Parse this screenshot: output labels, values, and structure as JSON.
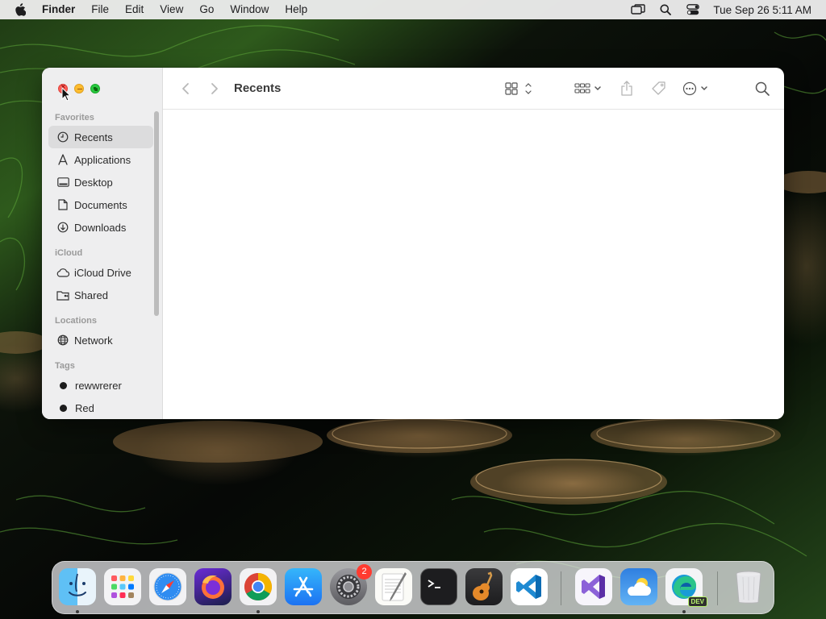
{
  "menubar": {
    "app_name": "Finder",
    "items": [
      "File",
      "Edit",
      "View",
      "Go",
      "Window",
      "Help"
    ],
    "clock": "Tue Sep 26  5:11 AM",
    "status_icons": [
      "screen-mirroring-icon",
      "spotlight-search-icon",
      "control-center-icon"
    ]
  },
  "finder": {
    "title": "Recents",
    "sidebar": {
      "sections": [
        {
          "header": "Favorites",
          "items": [
            {
              "label": "Recents",
              "icon": "clock-icon",
              "selected": true
            },
            {
              "label": "Applications",
              "icon": "applications-icon"
            },
            {
              "label": "Desktop",
              "icon": "desktop-icon"
            },
            {
              "label": "Documents",
              "icon": "document-icon"
            },
            {
              "label": "Downloads",
              "icon": "download-icon"
            }
          ]
        },
        {
          "header": "iCloud",
          "items": [
            {
              "label": "iCloud Drive",
              "icon": "cloud-icon"
            },
            {
              "label": "Shared",
              "icon": "shared-folder-icon"
            }
          ]
        },
        {
          "header": "Locations",
          "items": [
            {
              "label": "Network",
              "icon": "globe-icon"
            }
          ]
        },
        {
          "header": "Tags",
          "items": [
            {
              "label": "rewwrerer",
              "icon": "tag-dot",
              "color": "#1c1c1c"
            },
            {
              "label": "Red",
              "icon": "tag-dot",
              "color": "#1c1c1c"
            }
          ]
        }
      ]
    },
    "toolbar_icons": [
      "back-icon",
      "forward-icon",
      "icon-view-icon",
      "group-icon",
      "share-icon",
      "tag-icon",
      "more-actions-icon",
      "search-icon"
    ]
  },
  "dock": {
    "apps": [
      {
        "name": "Finder",
        "icon": "finder-icon",
        "running": true
      },
      {
        "name": "Launchpad",
        "icon": "launchpad-icon"
      },
      {
        "name": "Safari",
        "icon": "safari-icon"
      },
      {
        "name": "Firefox",
        "icon": "firefox-icon"
      },
      {
        "name": "Google Chrome",
        "icon": "chrome-icon",
        "running": true
      },
      {
        "name": "App Store",
        "icon": "app-store-icon"
      },
      {
        "name": "System Settings",
        "icon": "settings-icon",
        "badge": "2"
      },
      {
        "name": "TextEdit",
        "icon": "textedit-icon"
      },
      {
        "name": "Terminal",
        "icon": "terminal-icon"
      },
      {
        "name": "GarageBand",
        "icon": "garageband-icon"
      },
      {
        "name": "Visual Studio Code",
        "icon": "vscode-icon"
      },
      {
        "name": "Visual Studio",
        "icon": "visual-studio-icon"
      },
      {
        "name": "Weather",
        "icon": "weather-icon"
      },
      {
        "name": "Microsoft Edge Dev",
        "icon": "edge-dev-icon",
        "label": "DEV",
        "running": true
      },
      {
        "name": "Trash",
        "icon": "trash-icon"
      }
    ]
  },
  "colors": {
    "accent": "#0a84ff",
    "badge": "#ff3b30",
    "sidebar": "#eeeeef",
    "selected_row": "#dcdcdd"
  }
}
